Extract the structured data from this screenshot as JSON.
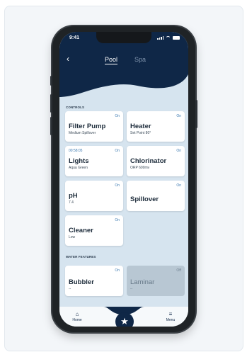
{
  "status_bar": {
    "time": "9:41"
  },
  "header": {
    "back_icon": "chevron-left-icon",
    "tabs": [
      {
        "label": "Pool",
        "active": true
      },
      {
        "label": "Spa",
        "active": false
      }
    ]
  },
  "controls": {
    "section_label": "CONTROLS",
    "tiles": [
      {
        "name": "Filter Pump",
        "sub": "Medium Spillover",
        "status": "On",
        "timer": ""
      },
      {
        "name": "Heater",
        "sub": "Set Point 80°",
        "status": "On",
        "timer": ""
      },
      {
        "name": "Lights",
        "sub": "Aqua Green",
        "status": "On",
        "timer": "00:58:05"
      },
      {
        "name": "Chlorinator",
        "sub": "ORP 600mv",
        "status": "On",
        "timer": ""
      },
      {
        "name": "pH",
        "sub": "7.4",
        "status": "On",
        "timer": ""
      },
      {
        "name": "Spillover",
        "sub": "",
        "status": "On",
        "timer": ""
      },
      {
        "name": "Cleaner",
        "sub": "Low",
        "status": "On",
        "timer": ""
      }
    ]
  },
  "water_features": {
    "section_label": "WATER FEATURES",
    "tiles": [
      {
        "name": "Bubbler",
        "sub": "--",
        "status": "On"
      },
      {
        "name": "Laminar",
        "sub": "--",
        "status": "Off"
      }
    ]
  },
  "bottom_nav": {
    "home_label": "Home",
    "menu_label": "Menu",
    "home_icon": "home-icon",
    "menu_icon": "menu-icon",
    "favorite_icon": "star-icon"
  },
  "colors": {
    "navy": "#0f2747",
    "screen_bg": "#d6e4ef",
    "accent_blue": "#3a78b0",
    "tile_off": "#b8c7d3"
  }
}
